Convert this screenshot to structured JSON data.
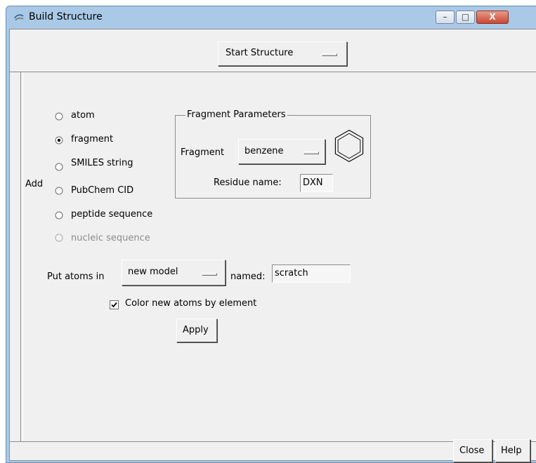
{
  "window": {
    "title": "Build Structure",
    "controls": {
      "minimize": "–",
      "maximize": "□",
      "close": "X"
    }
  },
  "top": {
    "mode_menu": {
      "label": "Start Structure"
    }
  },
  "add": {
    "label": "Add",
    "options": [
      {
        "label": "atom",
        "selected": false,
        "enabled": true
      },
      {
        "label": "fragment",
        "selected": true,
        "enabled": true
      },
      {
        "label": "SMILES string",
        "selected": false,
        "enabled": true
      },
      {
        "label": "PubChem CID",
        "selected": false,
        "enabled": true
      },
      {
        "label": "peptide sequence",
        "selected": false,
        "enabled": true
      },
      {
        "label": "nucleic sequence",
        "selected": false,
        "enabled": false
      }
    ]
  },
  "fragment_params": {
    "title": "Fragment Parameters",
    "fragment_label": "Fragment",
    "fragment_value": "benzene",
    "residue_label": "Residue name:",
    "residue_value": "DXN",
    "preview_icon": "benzene-ring-icon"
  },
  "placement": {
    "put_label": "Put atoms in",
    "model_value": "new model",
    "named_label": "named:",
    "named_value": "scratch"
  },
  "color_by_element": {
    "label": "Color new atoms by element",
    "checked": true
  },
  "apply_label": "Apply",
  "footer": {
    "close_label": "Close",
    "help_label": "Help"
  }
}
